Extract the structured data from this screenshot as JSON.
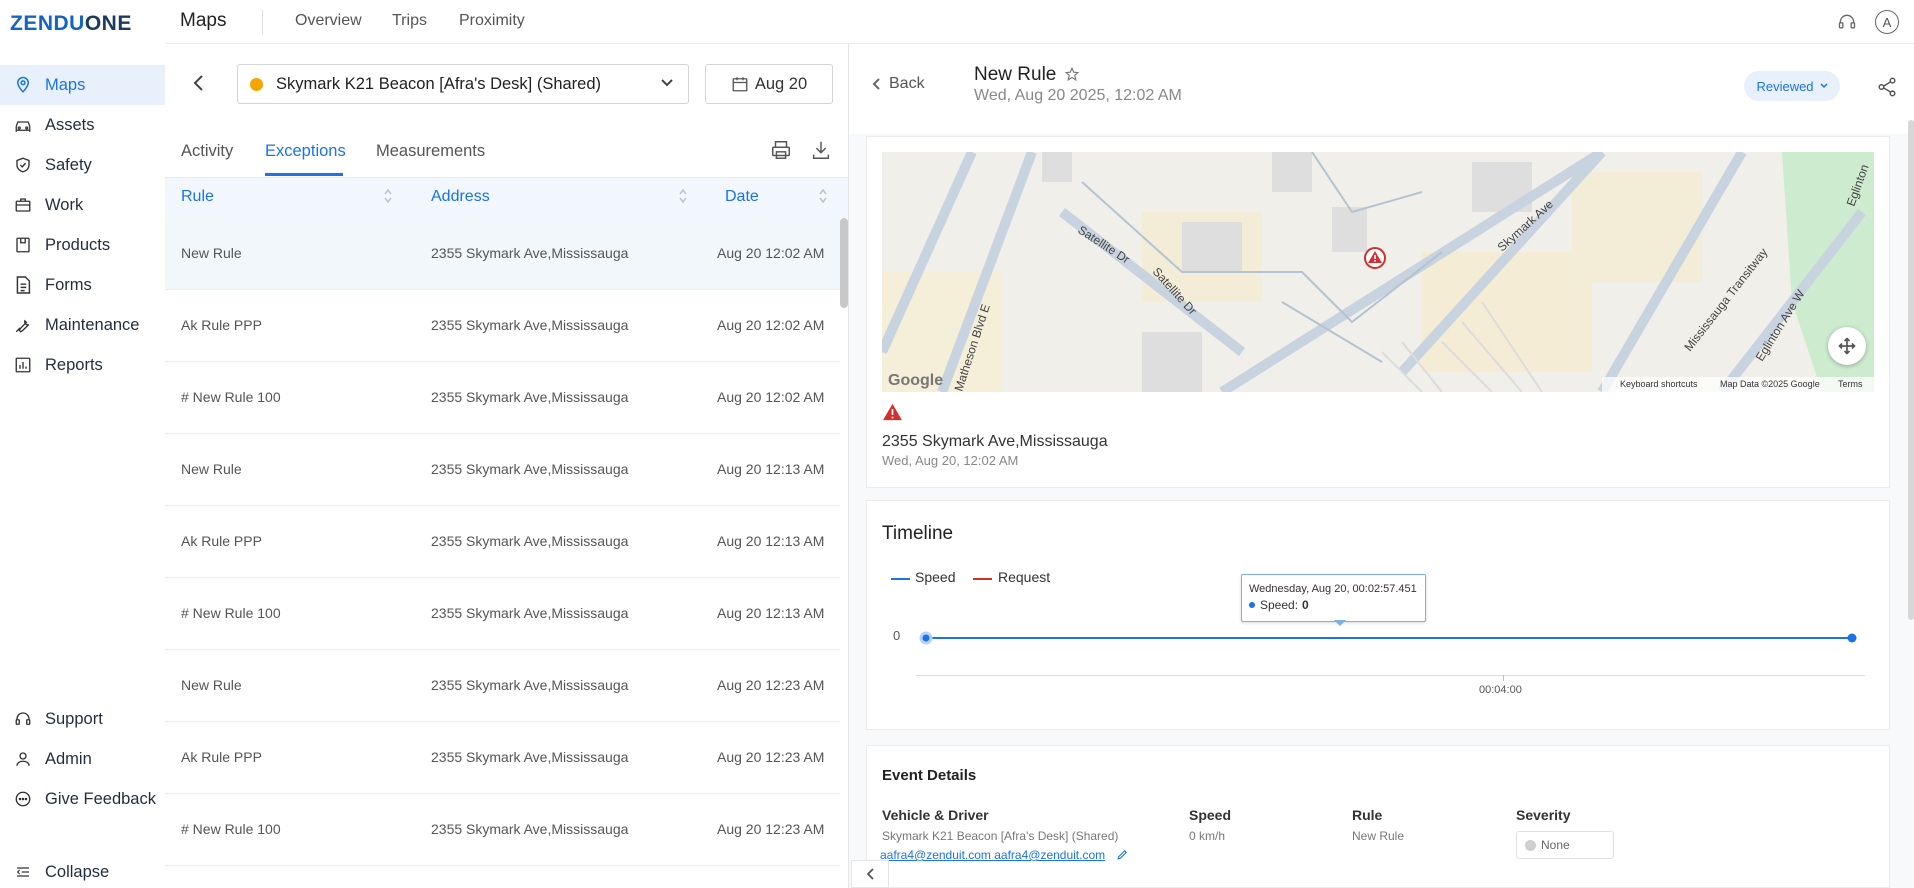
{
  "brand": {
    "logo_left": "ZENDU",
    "logo_right": "ONE"
  },
  "header": {
    "title": "Maps",
    "links": [
      "Overview",
      "Trips",
      "Proximity"
    ],
    "avatar_letter": "A"
  },
  "sidebar": {
    "items": [
      {
        "label": "Maps",
        "icon": "map-pin-icon",
        "active": true
      },
      {
        "label": "Assets",
        "icon": "car-icon"
      },
      {
        "label": "Safety",
        "icon": "shield-icon"
      },
      {
        "label": "Work",
        "icon": "briefcase-icon"
      },
      {
        "label": "Products",
        "icon": "box-icon"
      },
      {
        "label": "Forms",
        "icon": "form-icon"
      },
      {
        "label": "Maintenance",
        "icon": "wrench-icon"
      },
      {
        "label": "Reports",
        "icon": "chart-icon"
      }
    ],
    "bottom": [
      {
        "label": "Support",
        "icon": "headset-icon"
      },
      {
        "label": "Admin",
        "icon": "user-icon"
      },
      {
        "label": "Give Feedback",
        "icon": "chat-icon"
      }
    ],
    "collapse_label": "Collapse"
  },
  "left": {
    "vehicle": "Skymark K21 Beacon [Afra's Desk] (Shared)",
    "date": "Aug 20",
    "tabs": [
      "Activity",
      "Exceptions",
      "Measurements"
    ],
    "active_tab": "Exceptions",
    "columns": [
      "Rule",
      "Address",
      "Date"
    ],
    "rows": [
      {
        "rule": "New Rule",
        "address": "2355 Skymark Ave,Mississauga",
        "date": "Aug 20 12:02 AM"
      },
      {
        "rule": "Ak Rule PPP",
        "address": "2355 Skymark Ave,Mississauga",
        "date": "Aug 20 12:02 AM"
      },
      {
        "rule": "# New Rule 100",
        "address": "2355 Skymark Ave,Mississauga",
        "date": "Aug 20 12:02 AM"
      },
      {
        "rule": "New Rule",
        "address": "2355 Skymark Ave,Mississauga",
        "date": "Aug 20 12:13 AM"
      },
      {
        "rule": "Ak Rule PPP",
        "address": "2355 Skymark Ave,Mississauga",
        "date": "Aug 20 12:13 AM"
      },
      {
        "rule": "# New Rule 100",
        "address": "2355 Skymark Ave,Mississauga",
        "date": "Aug 20 12:13 AM"
      },
      {
        "rule": "New Rule",
        "address": "2355 Skymark Ave,Mississauga",
        "date": "Aug 20 12:23 AM"
      },
      {
        "rule": "Ak Rule PPP",
        "address": "2355 Skymark Ave,Mississauga",
        "date": "Aug 20 12:23 AM"
      },
      {
        "rule": "# New Rule 100",
        "address": "2355 Skymark Ave,Mississauga",
        "date": "Aug 20 12:23 AM"
      }
    ]
  },
  "detail": {
    "back_label": "Back",
    "title": "New Rule",
    "subtitle": "Wed, Aug 20 2025, 12:02 AM",
    "status": "Reviewed",
    "map": {
      "streets": [
        "Satellite Dr",
        "Satellite Dr",
        "Skymark Ave",
        "Matheson Blvd E",
        "Mississauga Transitway",
        "Eglinton Ave W",
        "Eglinton"
      ],
      "google_label": "Google",
      "footer": [
        "Keyboard shortcuts",
        "Map Data ©2025 Google",
        "Terms"
      ]
    },
    "address": "2355 Skymark Ave,Mississauga",
    "address_time": "Wed, Aug 20, 12:02 AM",
    "timeline": {
      "title": "Timeline",
      "legend": [
        {
          "label": "Speed",
          "color": "#1a73e8"
        },
        {
          "label": "Request",
          "color": "#d32f2f"
        }
      ],
      "y_label": "0",
      "x_tick": "00:04:00",
      "tooltip_title": "Wednesday, Aug 20, 00:02:57.451",
      "tooltip_label": "Speed:",
      "tooltip_value": "0"
    },
    "event_details": {
      "title": "Event Details",
      "vehicle_label": "Vehicle & Driver",
      "vehicle_value": "Skymark K21 Beacon [Afra's Desk] (Shared)",
      "driver_email": "aafra4@zenduit.com aafra4@zenduit.com",
      "speed_label": "Speed",
      "speed_value": "0 km/h",
      "rule_label": "Rule",
      "rule_value": "New Rule",
      "severity_label": "Severity",
      "severity_value": "None"
    }
  },
  "chart_data": {
    "type": "line",
    "series": [
      {
        "name": "Speed",
        "values": [
          0,
          0
        ]
      }
    ],
    "x": [
      "00:02:57.451",
      "end"
    ],
    "ylabel": "",
    "xlabel": "",
    "x_ticks": [
      "00:04:00"
    ],
    "y_ticks": [
      "0"
    ],
    "legend": [
      "Speed",
      "Request"
    ],
    "grid": false
  }
}
